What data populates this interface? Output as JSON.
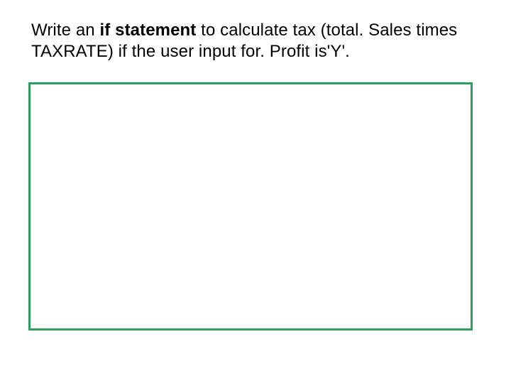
{
  "prompt": {
    "part1": "Write an ",
    "bold": "if statement",
    "part2": " to calculate tax (total. Sales times TAXRATE) if the user input for. Profit is'Y'."
  },
  "answer_box": {
    "content": ""
  },
  "colors": {
    "box_border": "#2e9e5b"
  }
}
